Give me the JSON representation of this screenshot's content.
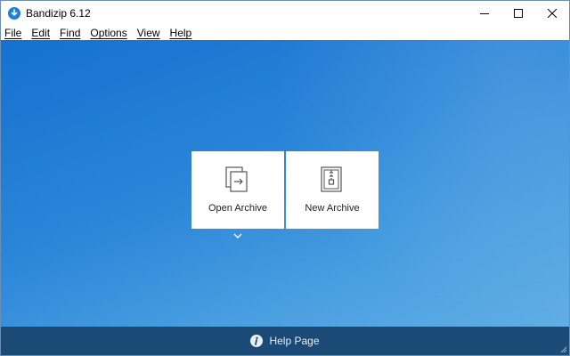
{
  "window": {
    "title": "Bandizip 6.12",
    "accent": "#1e7fd8"
  },
  "menu": {
    "items": [
      "File",
      "Edit",
      "Find",
      "Options",
      "View",
      "Help"
    ]
  },
  "actions": {
    "open_archive": "Open Archive",
    "new_archive": "New Archive"
  },
  "footer": {
    "help_label": "Help Page"
  },
  "icons": {
    "app": "bandizip-logo-icon",
    "open": "open-archive-icon",
    "new": "new-archive-icon",
    "more": "chevron-down-icon",
    "help": "info-icon"
  }
}
